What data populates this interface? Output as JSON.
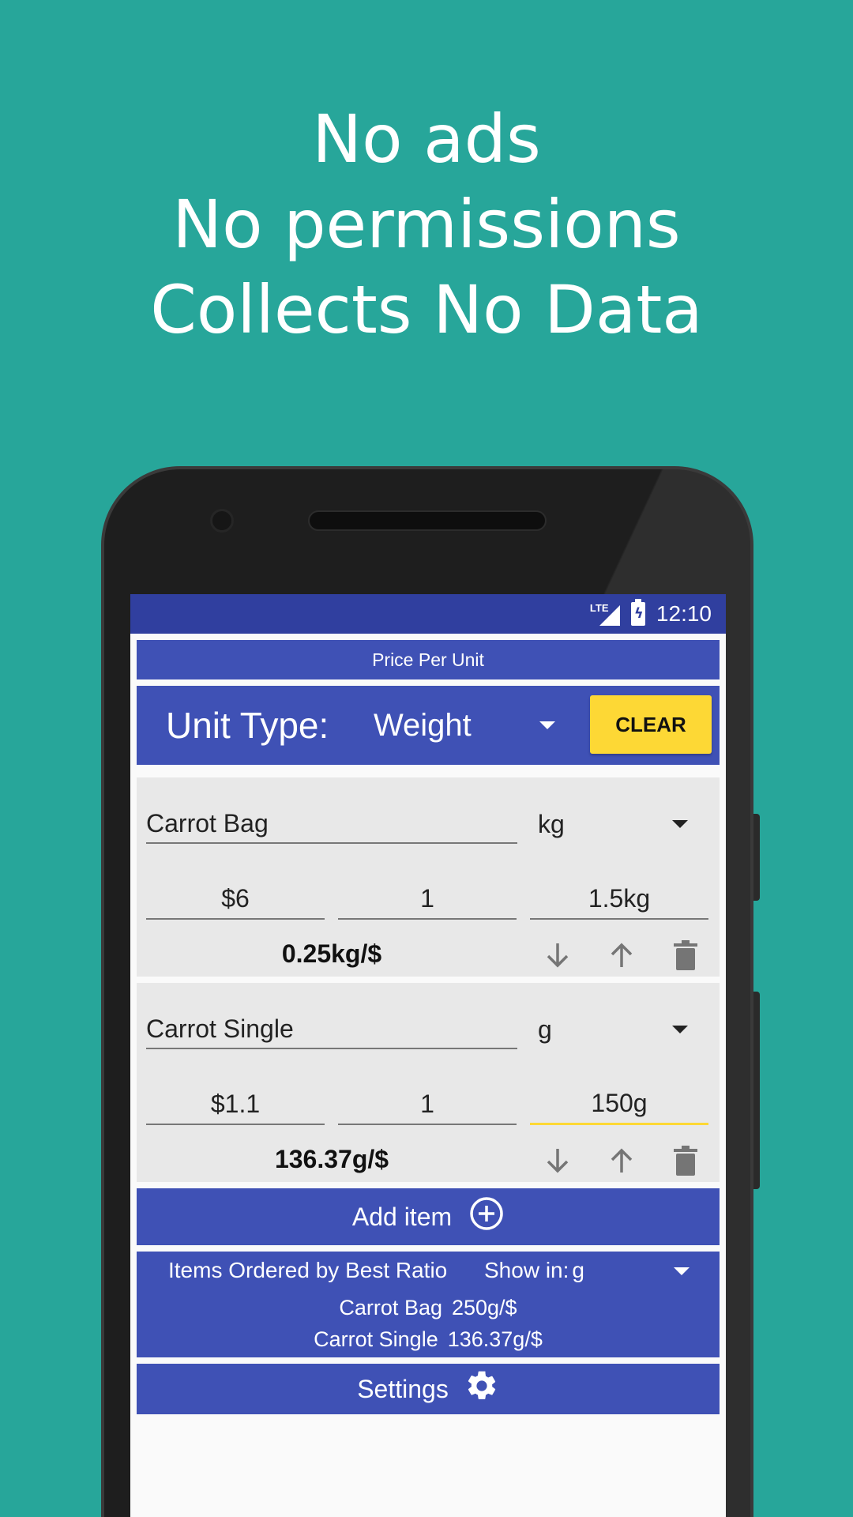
{
  "promo": {
    "line1": "No ads",
    "line2": "No permissions",
    "line3": "Collects No Data"
  },
  "status_bar": {
    "network": "LTE",
    "time": "12:10"
  },
  "app": {
    "title": "Price Per Unit",
    "unit_type_label": "Unit Type:",
    "unit_type_value": "Weight",
    "clear_label": "CLEAR"
  },
  "items": [
    {
      "name": "Carrot Bag",
      "unit": "kg",
      "price": "$6",
      "quantity": "1",
      "size": "1.5kg",
      "ratio": "0.25kg/$"
    },
    {
      "name": "Carrot Single",
      "unit": "g",
      "price": "$1.1",
      "quantity": "1",
      "size": "150g",
      "ratio": "136.37g/$"
    }
  ],
  "add_item_label": "Add item",
  "ordered": {
    "title": "Items Ordered by Best Ratio",
    "show_in_label": "Show in:",
    "show_in_value": "g",
    "results": [
      {
        "name": "Carrot Bag",
        "ratio": "250g/$"
      },
      {
        "name": "Carrot Single",
        "ratio": "136.37g/$"
      }
    ]
  },
  "settings_label": "Settings",
  "colors": {
    "background": "#27a69a",
    "primary": "#3f51b5",
    "primary_dark": "#303f9f",
    "accent": "#fdd835",
    "card": "#e8e8e8"
  },
  "icons": [
    "arrow-down-icon",
    "arrow-up-icon",
    "trash-icon",
    "plus-circle-icon",
    "gear-icon",
    "battery-icon",
    "signal-icon"
  ]
}
